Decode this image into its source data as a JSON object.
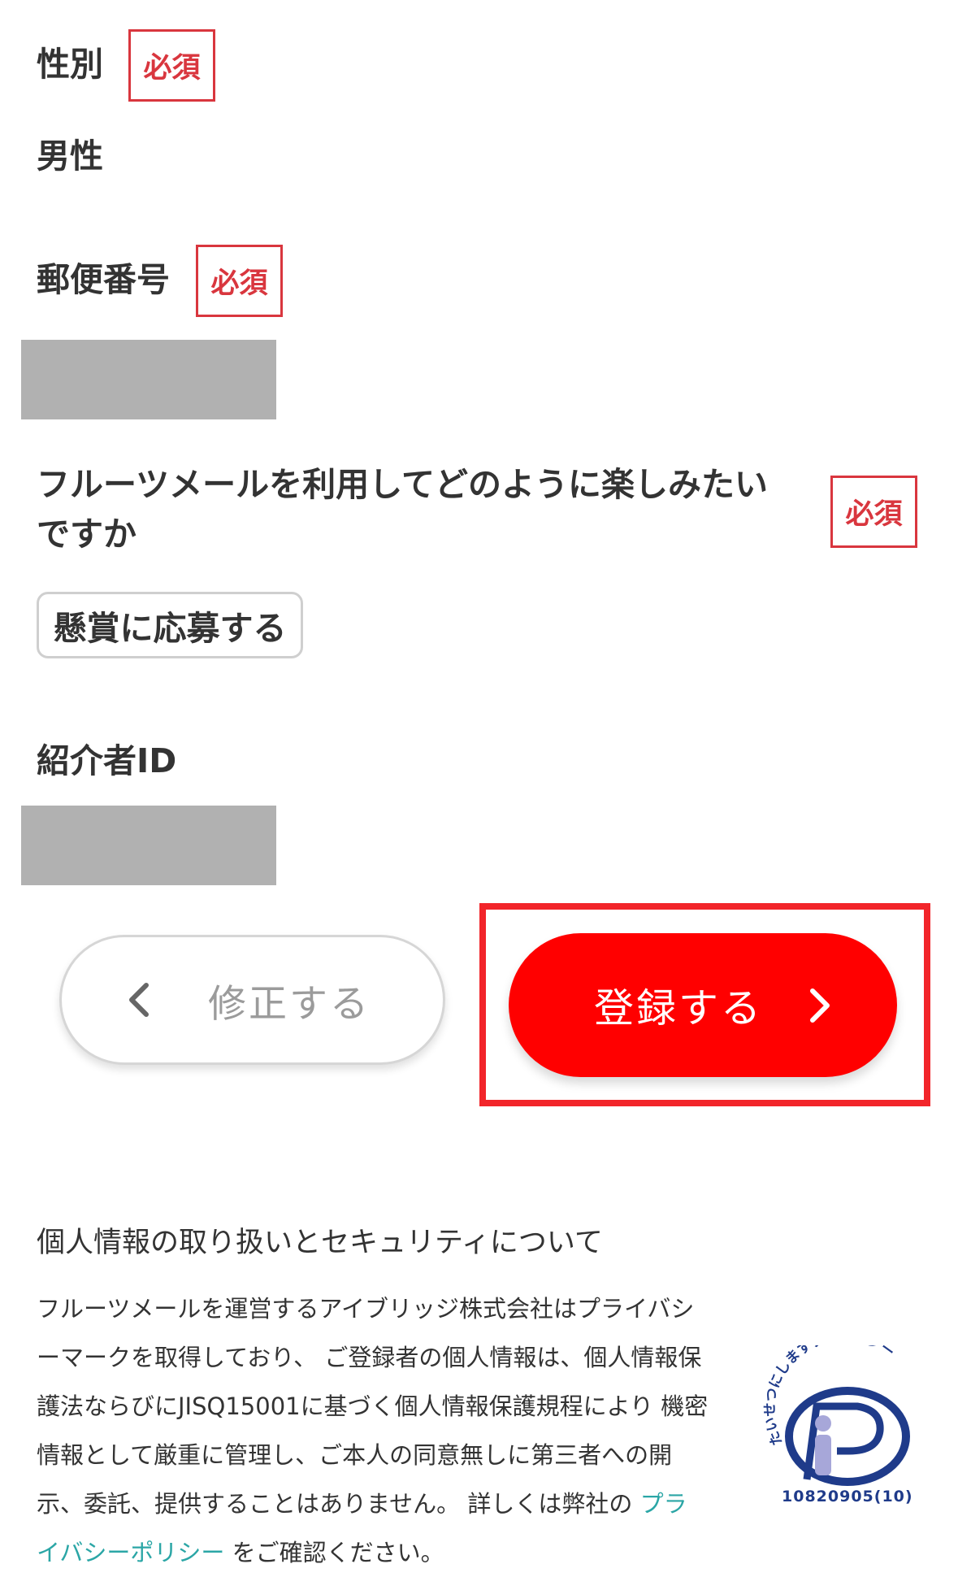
{
  "gender": {
    "label": "性別",
    "required": "必須",
    "value": "男性"
  },
  "postal": {
    "label": "郵便番号",
    "required": "必須"
  },
  "usage": {
    "label_line1": "フルーツメールを利用してどのように楽しみたい",
    "label_line2": "ですか",
    "required": "必須",
    "selected": "懸賞に応募する"
  },
  "referrer": {
    "label": "紹介者ID"
  },
  "buttons": {
    "back": "修正する",
    "submit": "登録する"
  },
  "privacy": {
    "title": "個人情報の取り扱いとセキュリティについて",
    "body_lines": [
      "フルーツメールを運営するアイブリッジ株式会社はプライバシ",
      "ーマークを取得しており、 ご登録者の個人情報は、個人情報保",
      "護法ならびにJISQ15001に基づく個人情報保護規程により 機密",
      "情報として厳重に管理し、ご本人の同意無しに第三者への開",
      "示、委託、提供することはありません。 詳しくは弊社の "
    ],
    "link_part1": "プラ",
    "link_part2": "イバシーポリシー",
    "body_end": " をご確認ください。",
    "mark_text": "たいせつにしますプライバシー",
    "mark_number": "10820905(10)"
  },
  "colors": {
    "required": "#d9363e",
    "submit": "#ff0000",
    "highlight": "#f2252a",
    "link": "#2ba6a6",
    "masked": "#b1b1b1"
  }
}
